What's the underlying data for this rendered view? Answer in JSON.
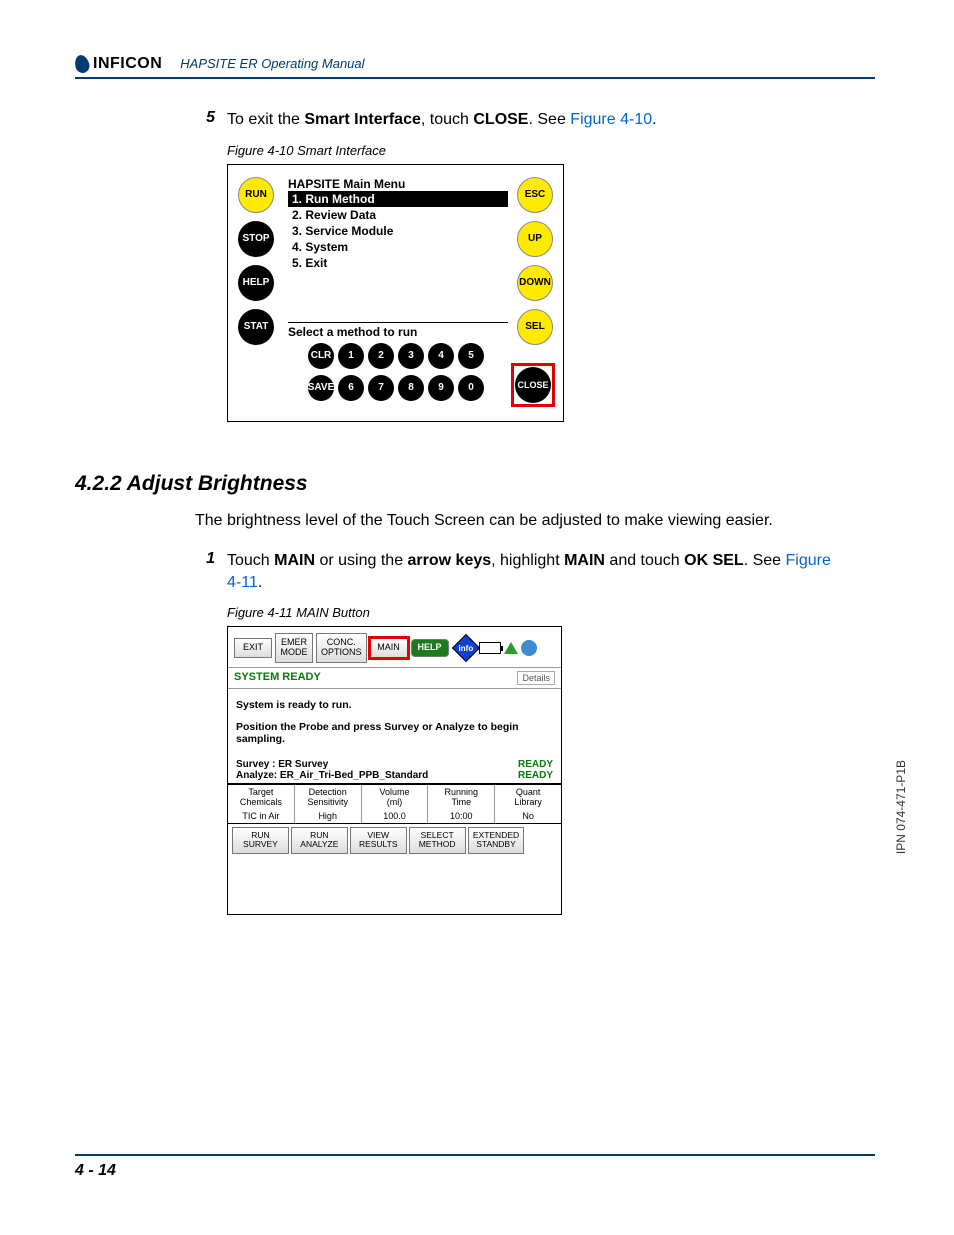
{
  "header": {
    "brand": "INFICON",
    "manual_title": "HAPSITE ER Operating Manual"
  },
  "step5": {
    "num": "5",
    "t1": "To exit the ",
    "b1": "Smart Interface",
    "t2": ", touch ",
    "b2": "CLOSE",
    "t3": ". See ",
    "link": "Figure 4-10",
    "t4": "."
  },
  "fig410": {
    "caption": "Figure 4-10  Smart Interface",
    "left_buttons": [
      "RUN",
      "STOP",
      "HELP",
      "STAT"
    ],
    "right_buttons": [
      "ESC",
      "UP",
      "DOWN",
      "SEL"
    ],
    "menu_title": "HAPSITE Main Menu",
    "menu_items": [
      "1. Run Method",
      "2. Review Data",
      "3. Service Module",
      "4. System",
      "5. Exit"
    ],
    "prompt": "Select a method to run",
    "row1": [
      "CLR",
      "1",
      "2",
      "3",
      "4",
      "5"
    ],
    "row2": [
      "SAVE",
      "6",
      "7",
      "8",
      "9",
      "0"
    ],
    "close": "CLOSE"
  },
  "section": "4.2.2  Adjust Brightness",
  "para": "The brightness level of the Touch Screen can be adjusted to make viewing easier.",
  "step1": {
    "num": "1",
    "t1": "Touch ",
    "b1": "MAIN",
    "t2": " or using the ",
    "b2": "arrow keys",
    "t3": ", highlight ",
    "b3": "MAIN",
    "t4": " and touch ",
    "b4": "OK SEL",
    "t5": ". See ",
    "link": "Figure 4-11",
    "t6": "."
  },
  "fig411": {
    "caption": "Figure 4-11  MAIN Button",
    "top_buttons": [
      "EXIT",
      "EMER\nMODE",
      "CONC.\nOPTIONS",
      "MAIN"
    ],
    "help": "HELP",
    "info": "info",
    "sysready": "SYSTEM READY",
    "details": "Details",
    "body_lines": [
      "System is ready to run.",
      "Position the Probe and press Survey or Analyze to begin sampling."
    ],
    "survey_label": "Survey : ER Survey",
    "analyze_label": "Analyze: ER_Air_Tri-Bed_PPB_Standard",
    "ready": "READY",
    "table_headers": [
      "Target\nChemicals",
      "Detection\nSensitivity",
      "Volume\n(ml)",
      "Running\nTime",
      "Quant\nLibrary"
    ],
    "table_values": [
      "TIC in Air",
      "High",
      "100.0",
      "10:00",
      "No"
    ],
    "bottom_buttons": [
      "RUN\nSURVEY",
      "RUN\nANALYZE",
      "VIEW\nRESULTS",
      "SELECT\nMETHOD",
      "EXTENDED\nSTANDBY"
    ]
  },
  "side_ipn": "IPN 074-471-P1B",
  "page_num": "4 - 14"
}
